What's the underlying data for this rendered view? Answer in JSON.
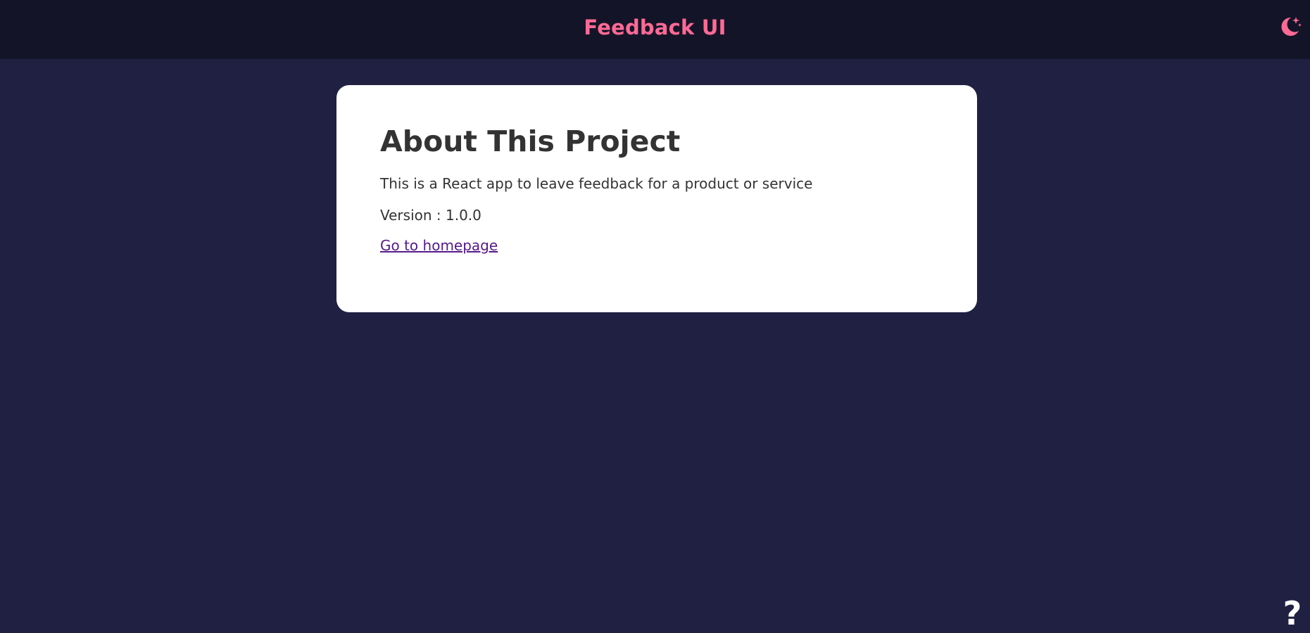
{
  "header": {
    "title": "Feedback UI",
    "theme_icon": "moon-stars-icon"
  },
  "about": {
    "heading": "About This Project",
    "description": "This is a React app to leave feedback for a product or service",
    "version": "Version : 1.0.0",
    "home_link": "Go to homepage"
  },
  "help": {
    "label": "?",
    "icon": "question-mark-icon"
  },
  "colors": {
    "background": "#202142",
    "header": "#141428",
    "accent": "#ff6a95",
    "card": "#ffffff",
    "text": "#333333",
    "link": "#551a8b"
  }
}
